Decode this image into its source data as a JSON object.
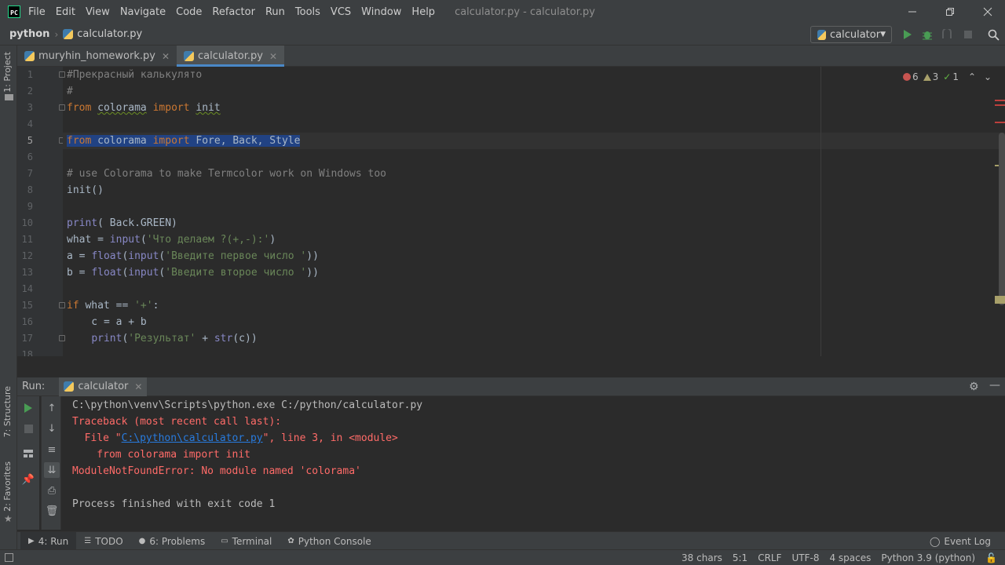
{
  "window": {
    "title": "calculator.py - calculator.py",
    "menu": [
      "File",
      "Edit",
      "View",
      "Navigate",
      "Code",
      "Refactor",
      "Run",
      "Tools",
      "VCS",
      "Window",
      "Help"
    ]
  },
  "navbar": {
    "breadcrumb": [
      "python",
      "calculator.py"
    ],
    "run_config": "calculator"
  },
  "left_stripe": {
    "project": "1: Project",
    "structure": "7: Structure",
    "favorites": "2: Favorites"
  },
  "editor_tabs": [
    {
      "label": "muryhin_homework.py",
      "active": false
    },
    {
      "label": "calculator.py",
      "active": true
    }
  ],
  "inspections": {
    "errors": "6",
    "warnings": "3",
    "weak": "1"
  },
  "editor": {
    "line_numbers": [
      "1",
      "2",
      "3",
      "4",
      "5",
      "6",
      "7",
      "8",
      "9",
      "10",
      "11",
      "12",
      "13",
      "14",
      "15",
      "16",
      "17",
      "18"
    ],
    "current_line": "5",
    "lines": [
      "#Прекрасный калькулято",
      "#",
      "from colorama import init",
      "",
      "from colorama import Fore, Back, Style",
      "",
      "# use Colorama to make Termcolor work on Windows too",
      "init()",
      "",
      "print( Back.GREEN)",
      "what = input('Что делаем ?(+,-):')",
      "a = float(input('Введите первое число '))",
      "b = float(input('Введите второе число '))",
      "",
      "if what == '+':",
      "    c = a + b",
      "    print('Результат' + str(c))"
    ]
  },
  "run_panel": {
    "label": "Run:",
    "tab": "calculator",
    "console": {
      "cmd": "C:\\python\\venv\\Scripts\\python.exe C:/python/calculator.py",
      "traceback": "Traceback (most recent call last):",
      "file_prefix": "  File \"",
      "file_link": "C:\\python\\calculator.py",
      "file_suffix": "\", line 3, in <module>",
      "source": "    from colorama import init",
      "error": "ModuleNotFoundError: No module named 'colorama'",
      "finished": "Process finished with exit code 1"
    }
  },
  "tool_tabs": [
    {
      "label": "4: Run",
      "icon": "play-icon",
      "active": true
    },
    {
      "label": "TODO",
      "icon": "list-icon",
      "active": false
    },
    {
      "label": "6: Problems",
      "icon": "problems-icon",
      "active": false
    },
    {
      "label": "Terminal",
      "icon": "terminal-icon",
      "active": false
    },
    {
      "label": "Python Console",
      "icon": "python-console-icon",
      "active": false
    }
  ],
  "event_log": "Event Log",
  "statusbar": {
    "chars": "38 chars",
    "position": "5:1",
    "line_sep": "CRLF",
    "encoding": "UTF-8",
    "indent": "4 spaces",
    "interpreter": "Python 3.9 (python)"
  },
  "colors": {
    "keyword": "#cc7832",
    "string": "#6a8759",
    "comment": "#808080",
    "error_text": "#ff6b68",
    "link": "#287bde",
    "selection": "#214283",
    "accent_tab": "#4a88c7"
  }
}
